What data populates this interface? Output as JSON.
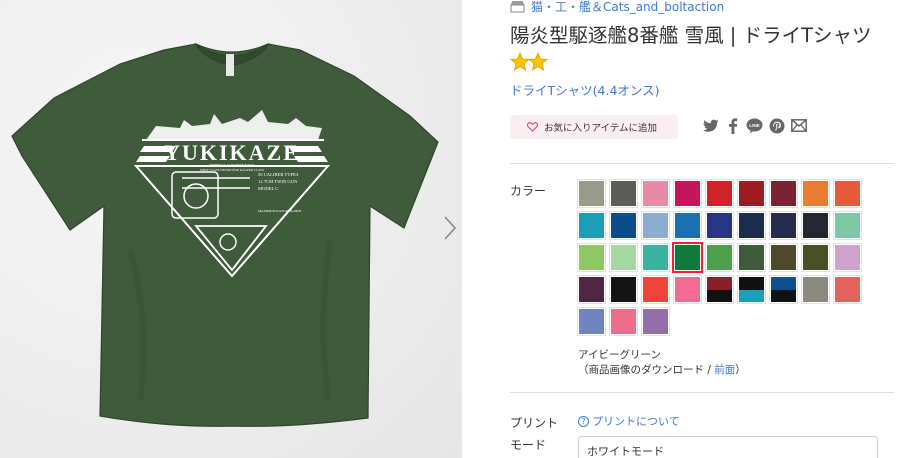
{
  "shop": {
    "name": "猫・工・艦＆Cats_and_boltaction",
    "icon": "shop-icon"
  },
  "product": {
    "title": "陽炎型駆逐艦8番艦 雪風 | ドライTシャツ",
    "title_emoji": "sparkle-stars-icon",
    "subtitle": "ドライTシャツ(4.4オンス)"
  },
  "favorite": {
    "label": "お気に入りアイテムに追加",
    "icon": "heart-icon"
  },
  "share_icons": [
    "twitter-icon",
    "facebook-icon",
    "line-icon",
    "pinterest-icon",
    "mail-icon"
  ],
  "share_line_text": "LINE",
  "color": {
    "label": "カラー",
    "selected_name": "アイビーグリーン",
    "download_prefix": "（商品画像のダウンロード / ",
    "download_link": "前面",
    "download_suffix": "）",
    "selected_index": 21,
    "swatches": [
      {
        "top": "#9a9a8a",
        "bottom": null
      },
      {
        "top": "#5c5c58",
        "bottom": null
      },
      {
        "top": "#ea8aa7",
        "bottom": null
      },
      {
        "top": "#c2185b",
        "bottom": null
      },
      {
        "top": "#cf2229",
        "bottom": null
      },
      {
        "top": "#9b1c22",
        "bottom": null
      },
      {
        "top": "#7a2431",
        "bottom": null
      },
      {
        "top": "#ec7b32",
        "bottom": null
      },
      {
        "top": "#e45b3c",
        "bottom": null
      },
      {
        "top": "#1b9eb6",
        "bottom": null
      },
      {
        "top": "#0b4c8c",
        "bottom": null
      },
      {
        "top": "#8dadd0",
        "bottom": null
      },
      {
        "top": "#1c6fb5",
        "bottom": null
      },
      {
        "top": "#283585",
        "bottom": null
      },
      {
        "top": "#1b2d4a",
        "bottom": null
      },
      {
        "top": "#272c4d",
        "bottom": null
      },
      {
        "top": "#23282e",
        "bottom": null
      },
      {
        "top": "#7ec7a6",
        "bottom": null
      },
      {
        "top": "#8fc763",
        "bottom": null
      },
      {
        "top": "#a6d7a0",
        "bottom": null
      },
      {
        "top": "#3ab3a1",
        "bottom": null
      },
      {
        "top": "#0f7a3c",
        "bottom": null
      },
      {
        "top": "#4fa04a",
        "bottom": null
      },
      {
        "top": "#3f5b3b",
        "bottom": null
      },
      {
        "top": "#4d4a2c",
        "bottom": null
      },
      {
        "top": "#495026",
        "bottom": null
      },
      {
        "top": "#cfa2cd",
        "bottom": null
      },
      {
        "top": "#4f2745",
        "bottom": null
      },
      {
        "top": "#141414",
        "bottom": null
      },
      {
        "top": "#f0453a",
        "bottom": null
      },
      {
        "top": "#f06c93",
        "bottom": null
      },
      {
        "top": "#8a1f27",
        "bottom": "#111111"
      },
      {
        "top": "#111111",
        "bottom": "#1aa0b8"
      },
      {
        "top": "#0e4f8f",
        "bottom": "#111111"
      },
      {
        "top": "#8d8880",
        "bottom": null
      },
      {
        "top": "#e0645c",
        "bottom": null
      },
      {
        "top": "#6f83bd",
        "bottom": null
      },
      {
        "top": "#ec6e8a",
        "bottom": null
      },
      {
        "top": "#946ea8",
        "bottom": null
      }
    ]
  },
  "print": {
    "label_line1": "プリント",
    "label_line2": "モード",
    "help_link": "プリントについて",
    "mode_value": "ホワイトモード"
  },
  "artwork": {
    "shirt_color": "#3f5b3b",
    "print_color": "#ffffff",
    "ship_name": "YUKIKAZE",
    "small_line1": "IMPERIAL JAPANESE NAVY",
    "small_line2": "FIRST CLASS DESTROYER KAGERO CLASS",
    "spec1": "50 CALIBER TYPE3",
    "spec2": "12.7CM TWIN GUN",
    "spec3": "MODEL C",
    "spec4": "MAXIMUM RANGE 18,400M"
  },
  "accent": "#3a7bd5"
}
